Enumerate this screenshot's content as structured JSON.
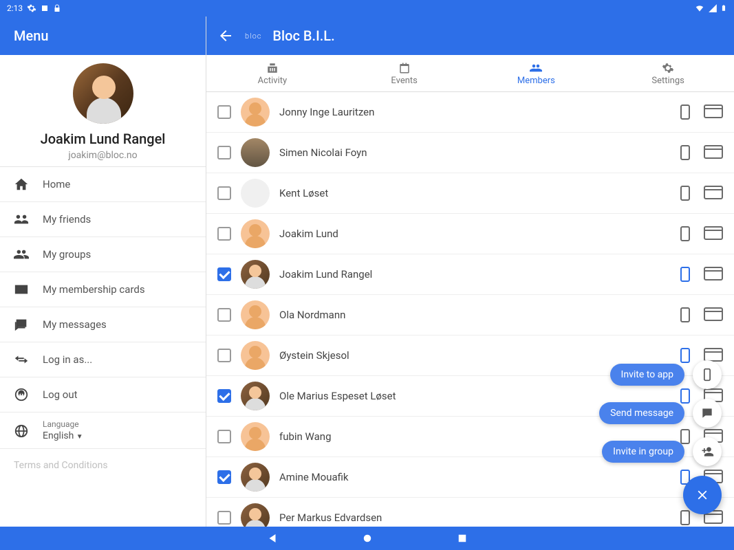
{
  "status": {
    "time": "2:13",
    "icons": [
      "gear",
      "square",
      "lock"
    ]
  },
  "sidebar": {
    "title": "Menu",
    "profile": {
      "name": "Joakim Lund Rangel",
      "email": "joakim@bloc.no"
    },
    "items": [
      {
        "label": "Home",
        "icon": "home"
      },
      {
        "label": "My friends",
        "icon": "friends"
      },
      {
        "label": "My groups",
        "icon": "groups"
      },
      {
        "label": "My membership cards",
        "icon": "card"
      },
      {
        "label": "My messages",
        "icon": "messages"
      },
      {
        "label": "Log in as...",
        "icon": "swap"
      },
      {
        "label": "Log out",
        "icon": "logout"
      }
    ],
    "language": {
      "label": "Language",
      "value": "English"
    },
    "terms": "Terms and Conditions"
  },
  "header": {
    "brand": "bloc",
    "title": "Bloc B.I.L."
  },
  "tabs": [
    {
      "label": "Activity"
    },
    {
      "label": "Events"
    },
    {
      "label": "Members"
    },
    {
      "label": "Settings"
    }
  ],
  "activeTab": 2,
  "members": [
    {
      "name": "Jonny Inge Lauritzen",
      "checked": false,
      "avatar": "default",
      "phoneActive": false
    },
    {
      "name": "Simen Nicolai Foyn",
      "checked": false,
      "avatar": "build",
      "phoneActive": false
    },
    {
      "name": "Kent Løset",
      "checked": false,
      "avatar": "pattern",
      "phoneActive": false
    },
    {
      "name": "Joakim Lund",
      "checked": false,
      "avatar": "default",
      "phoneActive": false
    },
    {
      "name": "Joakim Lund Rangel",
      "checked": true,
      "avatar": "photo",
      "phoneActive": true
    },
    {
      "name": "Ola Nordmann",
      "checked": false,
      "avatar": "default",
      "phoneActive": false
    },
    {
      "name": "Øystein Skjesol",
      "checked": false,
      "avatar": "default",
      "phoneActive": true
    },
    {
      "name": "Ole Marius Espeset Løset",
      "checked": true,
      "avatar": "photo",
      "phoneActive": true
    },
    {
      "name": "fubin Wang",
      "checked": false,
      "avatar": "default",
      "phoneActive": false
    },
    {
      "name": "Amine Mouafik",
      "checked": true,
      "avatar": "photo",
      "phoneActive": true
    },
    {
      "name": "Per Markus Edvardsen",
      "checked": false,
      "avatar": "photo",
      "phoneActive": false
    }
  ],
  "fab": {
    "actions": [
      {
        "label": "Invite to app",
        "icon": "phone"
      },
      {
        "label": "Send message",
        "icon": "chat"
      },
      {
        "label": "Invite in group",
        "icon": "personadd"
      }
    ]
  }
}
